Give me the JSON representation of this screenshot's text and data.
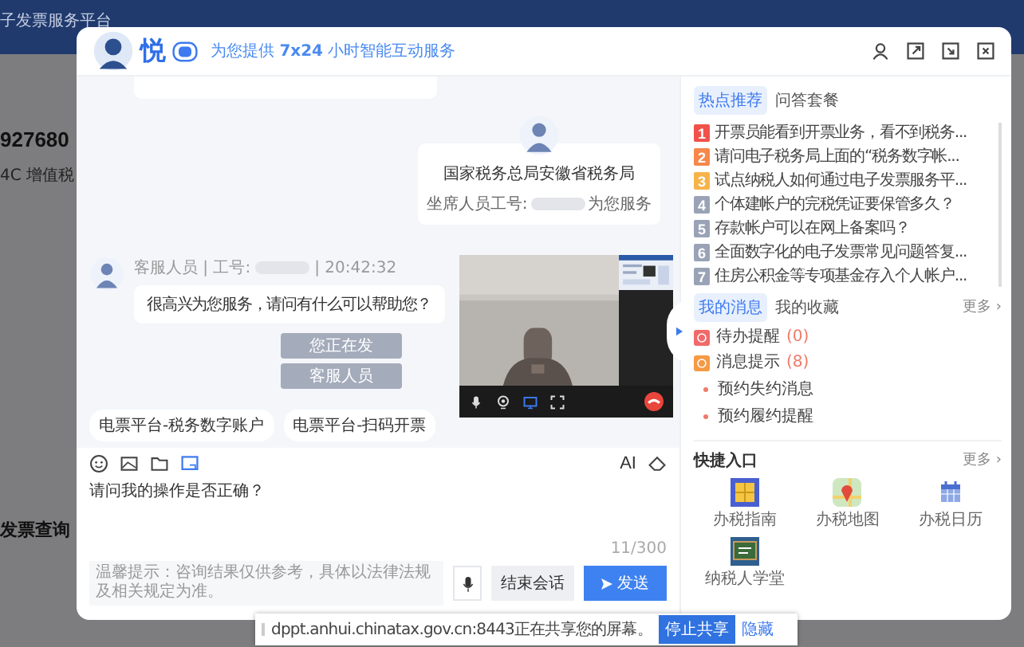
{
  "background": {
    "title": "子发票服务平台",
    "amount": "927680",
    "subtitle": "4C 增值税",
    "tile": "发票查询"
  },
  "header": {
    "logo": "悦",
    "tagline": "为您提供 **7x24** 小时智能互动服务"
  },
  "chat": {
    "agent_card": {
      "org": "国家税务总局安徽省税务局",
      "prefix": "坐席人员工号:",
      "suffix": "为您服务"
    },
    "message": {
      "sender": "客服人员 | 工号:",
      "time": "| 20:42:32",
      "text": "很高兴为您服务，请问有什么可以帮助您？"
    },
    "notices": [
      "您正在发",
      "客服人员"
    ],
    "chips": [
      "电票平台-税务数字账户",
      "电票平台-扫码开票"
    ]
  },
  "composer": {
    "ai_label": "AI",
    "value": "请问我的操作是否正确？",
    "counter": "11/300",
    "hint": "温馨提示：咨询结果仅供参考，具体以法律法规及相关规定为准。",
    "end_button": "结束会话",
    "send_button": "发送"
  },
  "hot": {
    "tabs": [
      {
        "label": "热点推荐",
        "selected": true
      },
      {
        "label": "问答套餐",
        "selected": false
      }
    ],
    "items": [
      {
        "number": "1",
        "text": "开票员能看到开票业务，看不到税务...",
        "color": "#f0524b"
      },
      {
        "number": "2",
        "text": "请问电子税务局上面的“税务数字帐...",
        "color": "#f5884a"
      },
      {
        "number": "3",
        "text": "试点纳税人如何通过电子发票服务平...",
        "color": "#f7b34a"
      },
      {
        "number": "4",
        "text": "个体建帐户的完税凭证要保管多久？",
        "color": "#9aa3b6"
      },
      {
        "number": "5",
        "text": "存款帐户可以在网上备案吗？",
        "color": "#9aa3b6"
      },
      {
        "number": "6",
        "text": "全面数字化的电子发票常见问题答复...",
        "color": "#9aa3b6"
      },
      {
        "number": "7",
        "text": "住房公积金等专项基金存入个人帐户...",
        "color": "#9aa3b6"
      }
    ]
  },
  "messages": {
    "tabs": [
      {
        "label": "我的消息",
        "selected": true
      },
      {
        "label": "我的收藏",
        "selected": false
      }
    ],
    "more": "更多 ›",
    "alerts": [
      {
        "label": "待办提醒",
        "count": "(0)",
        "color": "#f06a6a"
      },
      {
        "label": "消息提示",
        "count": "(8)",
        "color": "#f59a45"
      }
    ],
    "subitems": [
      "预约失约消息",
      "预约履约提醒"
    ]
  },
  "quick": {
    "title": "快捷入口",
    "more": "更多 ›",
    "tiles": [
      {
        "label": "办税指南",
        "kind": "guide"
      },
      {
        "label": "办税地图",
        "kind": "map"
      },
      {
        "label": "办税日历",
        "kind": "calendar"
      },
      {
        "label": "纳税人学堂",
        "kind": "school"
      }
    ]
  },
  "share_bar": {
    "text": "dppt.anhui.chinatax.gov.cn:8443正在共享您的屏幕。",
    "stop_button": "停止共享",
    "hide_link": "隐藏"
  }
}
